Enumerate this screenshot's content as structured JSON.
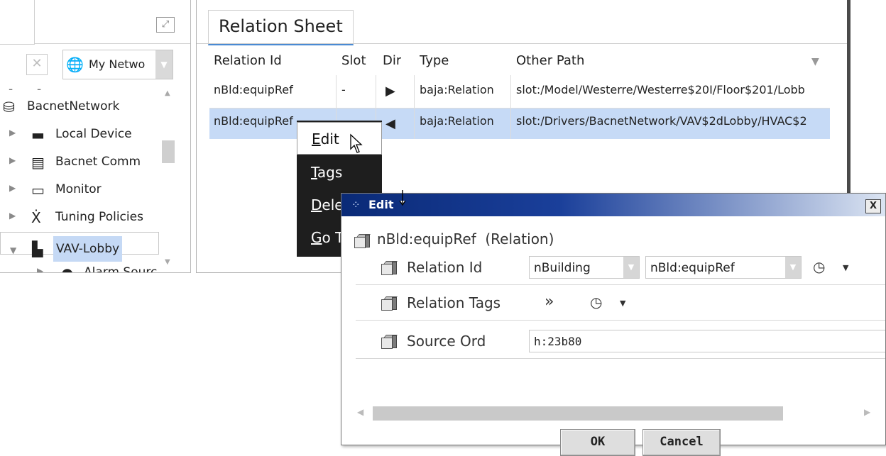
{
  "nav": {
    "network_selector": "My Netwo",
    "tree": [
      {
        "label": "BacnetNetwork",
        "icon": "network-icon"
      },
      {
        "label": "Local Device",
        "icon": "device-icon"
      },
      {
        "label": "Bacnet Comm",
        "icon": "comm-icon"
      },
      {
        "label": "Monitor",
        "icon": "monitor-icon"
      },
      {
        "label": "Tuning Policies",
        "icon": "tuning-icon"
      },
      {
        "label": "VAV-Lobby",
        "icon": "vav-icon"
      },
      {
        "label": "Alarm Sourc",
        "icon": "alarm-icon"
      }
    ]
  },
  "sheet": {
    "tab_label": "Relation Sheet",
    "columns": [
      "Relation Id",
      "Slot",
      "Dir",
      "Type",
      "Other Path"
    ],
    "rows": [
      {
        "relation_id": "nBld:equipRef",
        "slot": "-",
        "dir": "out",
        "type": "baja:Relation",
        "other_path": "slot:/Model/Westerre/Westerre$20I/Floor$201/Lobb"
      },
      {
        "relation_id": "nBld:equipRef",
        "slot": "",
        "dir": "in",
        "type": "baja:Relation",
        "other_path": "slot:/Drivers/BacnetNetwork/VAV$2dLobby/HVAC$2"
      }
    ]
  },
  "context_menu": {
    "items": [
      {
        "first": "E",
        "rest": "dit"
      },
      {
        "first": "T",
        "rest": "ags"
      },
      {
        "first": "D",
        "rest": "ele"
      },
      {
        "first": "G",
        "rest": "o T"
      }
    ]
  },
  "dialog": {
    "title": "Edit",
    "close": "X",
    "header": "nBld:equipRef  (Relation)",
    "fields": {
      "relation_id_label": "Relation Id",
      "relation_id_ns": "nBuilding",
      "relation_id_value": "nBld:equipRef",
      "relation_tags_label": "Relation Tags",
      "source_ord_label": "Source Ord",
      "source_ord_value": "h:23b80"
    },
    "ok_label": "OK",
    "cancel_label": "Cancel"
  },
  "colors": {
    "selection": "#c6daf6",
    "title_bar": "#0a2a77",
    "tab_underline": "#4a8ad3",
    "menu_bg": "#1e1e1e"
  }
}
